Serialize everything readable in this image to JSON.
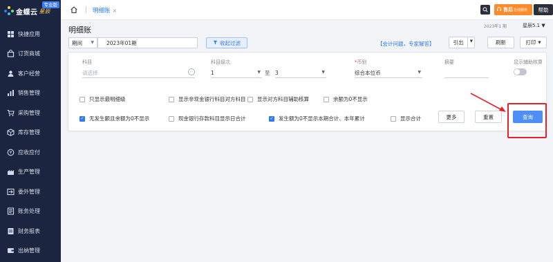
{
  "sidebar": {
    "logo_text": "金蝶云",
    "logo_sub": "星辰",
    "pro_badge": "专业版",
    "items": [
      {
        "label": "快捷应用",
        "icon": "grid-icon"
      },
      {
        "label": "订货商城",
        "icon": "shopping-bag-icon"
      },
      {
        "label": "客户经营",
        "icon": "user-icon"
      },
      {
        "label": "销售管理",
        "icon": "chart-icon"
      },
      {
        "label": "采购管理",
        "icon": "cart-icon"
      },
      {
        "label": "库存管理",
        "icon": "box-icon"
      },
      {
        "label": "应收应付",
        "icon": "coin-icon"
      },
      {
        "label": "生产管理",
        "icon": "factory-icon"
      },
      {
        "label": "委外管理",
        "icon": "outsource-icon"
      },
      {
        "label": "账务处理",
        "icon": "ledger-icon"
      },
      {
        "label": "财务报表",
        "icon": "report-icon"
      },
      {
        "label": "出纳管理",
        "icon": "cashier-icon"
      }
    ]
  },
  "topbar": {
    "tab_label": "明细账",
    "tab_close": "×",
    "service_label": "售后",
    "service_sub": "在线服务",
    "help_label": "帮助"
  },
  "header": {
    "page_title": "明细账",
    "period_info_prefix": "2023年",
    "period_info_num": "1",
    "period_info_suffix": " 期",
    "version": "星辰5.1 ▼"
  },
  "toolbar": {
    "period_select_label": "期间",
    "period_value": "2023年01期",
    "filter_label": "收起过滤",
    "consult_link": "【会计问题，专家解答】",
    "import_label": "引出",
    "refresh_label": "刷新",
    "print_label": "打印"
  },
  "filter": {
    "subject_label": "科目",
    "subject_placeholder": "请选择",
    "level_label": "科目级次",
    "level_from": "1",
    "level_sep": "至",
    "level_to": "3",
    "currency_label": "币别",
    "currency_required": "*",
    "currency_value": "综合本位币",
    "summary_label": "摘要",
    "summary_value": "",
    "aux_label": "显示辅助核算",
    "aux_enabled": false,
    "checkboxes_row1": [
      {
        "label": "只显示最明细级",
        "checked": false
      },
      {
        "label": "显示非现金银行科目对方科目",
        "checked": false
      },
      {
        "label": "显示对方科目辅助核算",
        "checked": false
      },
      {
        "label": "余额为0不显示",
        "checked": false
      }
    ],
    "checkboxes_row2": [
      {
        "label": "无发生额且余额为0不显示",
        "checked": true
      },
      {
        "label": "现金银行存款科目显示日合计",
        "checked": false
      },
      {
        "label": "发生额为0不显示本期合计、本年累计",
        "checked": true
      },
      {
        "label": "显示合计",
        "checked": false
      }
    ],
    "more_label": "更多",
    "reset_label": "重置",
    "query_label": "查询"
  },
  "colors": {
    "accent": "#2f7bf2",
    "query_button": "#4e8ff7",
    "sidebar_bg": "#1c2540",
    "annotation": "#e8202a",
    "service_orange": "#ff8a2a"
  }
}
